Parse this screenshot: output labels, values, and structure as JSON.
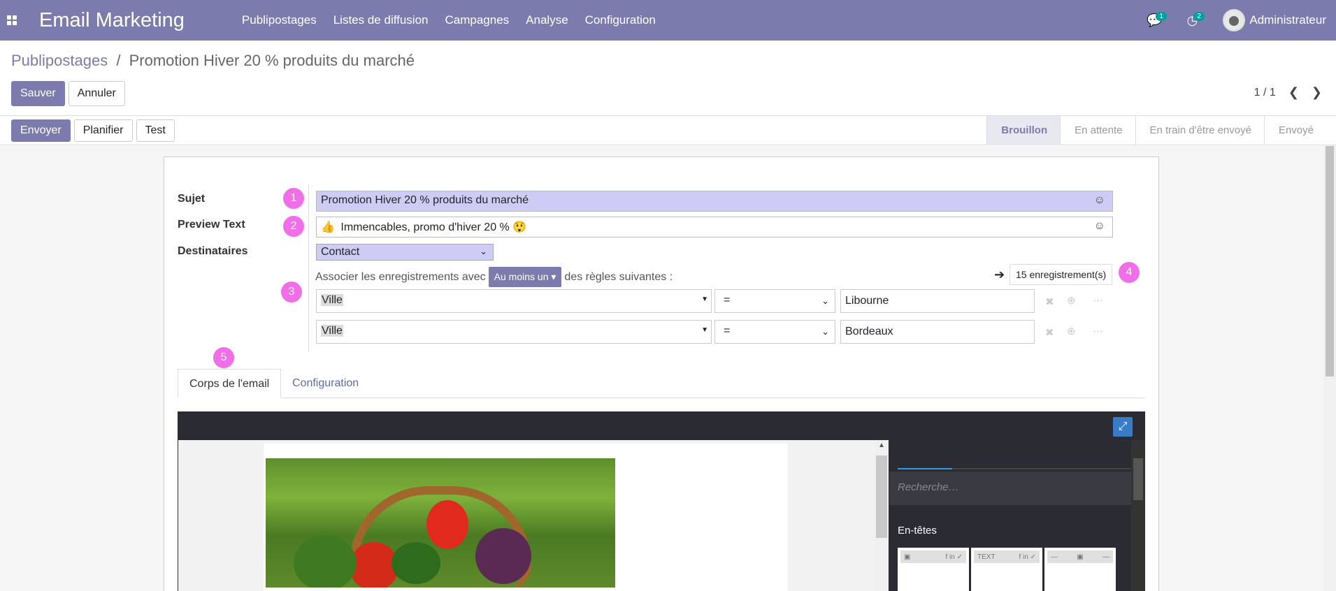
{
  "navbar": {
    "app_title": "Email Marketing",
    "menu": [
      "Publipostages",
      "Listes de diffusion",
      "Campagnes",
      "Analyse",
      "Configuration"
    ],
    "messages_count": "1",
    "activities_count": "2",
    "user": "Administrateur",
    "color": "#7c7bad"
  },
  "breadcrumb": {
    "parent": "Publipostages",
    "separator": "/",
    "current": "Promotion Hiver 20 % produits du marché"
  },
  "control": {
    "save_label": "Sauver",
    "cancel_label": "Annuler",
    "pager": "1 / 1"
  },
  "statusbar": {
    "send_label": "Envoyer",
    "schedule_label": "Planifier",
    "test_label": "Test",
    "stages": [
      "Brouillon",
      "En attente",
      "En train d'être envoyé",
      "Envoyé"
    ],
    "active_stage": "Brouillon"
  },
  "form": {
    "subject_label": "Sujet",
    "subject_value": "Promotion Hiver 20 % produits du marché",
    "preview_label": "Preview Text",
    "preview_value": "Immencables, promo d'hiver 20 %",
    "recipients_label": "Destinataires",
    "recipients_value": "Contact",
    "assoc_prefix": "Associer les enregistrements avec",
    "assoc_dropdown": "Au moins un",
    "assoc_suffix": "des règles suivantes :",
    "records_button": "15 enregistrement(s)",
    "rules": [
      {
        "field": "Ville",
        "operator": "=",
        "value": "Libourne"
      },
      {
        "field": "Ville",
        "operator": "=",
        "value": "Bordeaux"
      }
    ],
    "markers": [
      "1",
      "2",
      "3",
      "4",
      "5"
    ]
  },
  "tabs": {
    "body": "Corps de l'email",
    "config": "Configuration"
  },
  "editor": {
    "search_placeholder": "Recherche…",
    "snippets_heading": "En-têtes",
    "block_text_label": "TEXT"
  }
}
